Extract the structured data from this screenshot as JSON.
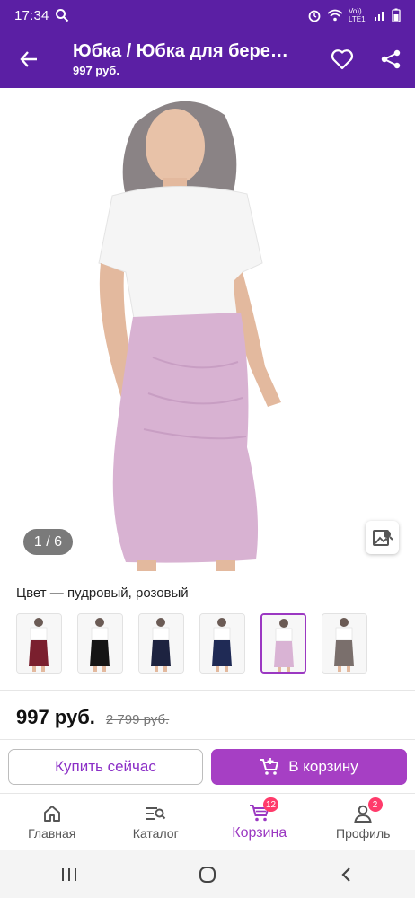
{
  "status_bar": {
    "time": "17:34",
    "network": "Vo)) LTE1"
  },
  "app_bar": {
    "title": "Юбка / Юбка для бере…",
    "subtitle": "997 руб."
  },
  "gallery": {
    "counter": "1 / 6"
  },
  "color": {
    "label": "Цвет — пудровый, розовый"
  },
  "swatches": [
    {
      "skirt": "#7a1f2e"
    },
    {
      "skirt": "#151515"
    },
    {
      "skirt": "#1d2340"
    },
    {
      "skirt": "#1f2a55"
    },
    {
      "skirt": "#d9b3d4",
      "selected": true
    },
    {
      "skirt": "#7a6f6c"
    }
  ],
  "price": {
    "current": "997 руб.",
    "old": "2 799 руб."
  },
  "actions": {
    "buy_now": "Купить сейчас",
    "add_to_cart": "В корзину"
  },
  "bottom_nav": [
    {
      "label": "Главная",
      "icon": "home-icon"
    },
    {
      "label": "Каталог",
      "icon": "catalog-search-icon"
    },
    {
      "label": "Корзина",
      "icon": "cart-icon",
      "badge": "12",
      "active": true
    },
    {
      "label": "Профиль",
      "icon": "profile-icon",
      "badge": "2"
    }
  ],
  "colors": {
    "brand": "#5b1fa4",
    "accent": "#a63fc4",
    "badge": "#ff3b6b"
  }
}
